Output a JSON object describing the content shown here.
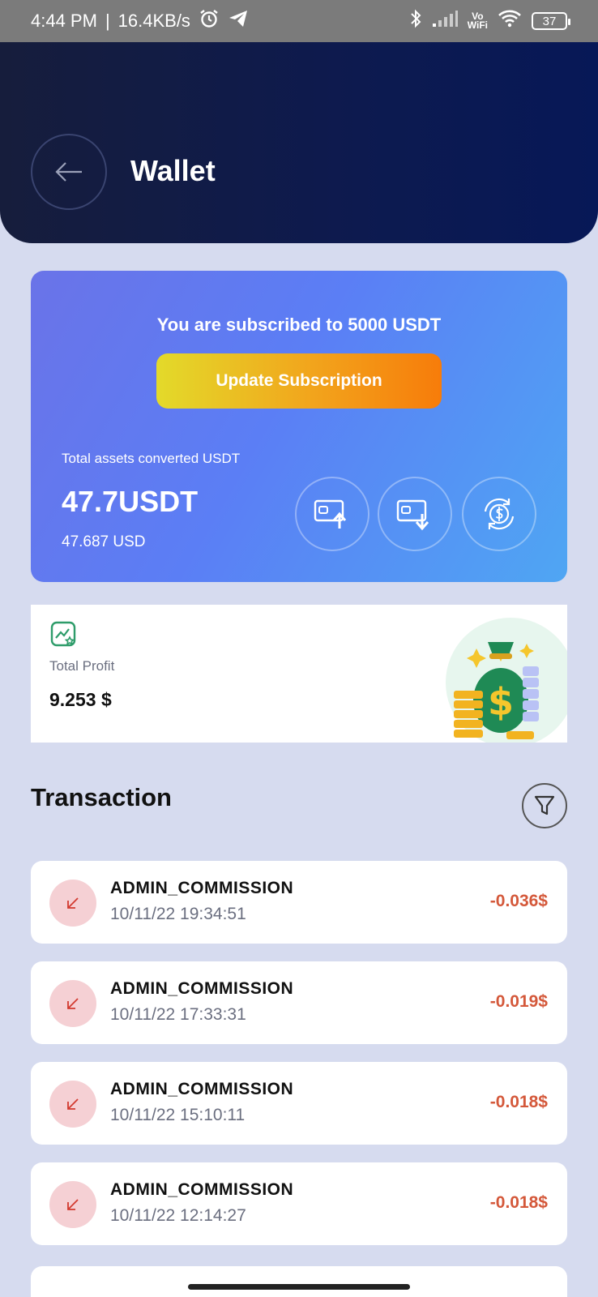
{
  "status_bar": {
    "time": "4:44 PM",
    "separator": "|",
    "speed": "16.4KB/s",
    "vowifi_top": "Vo",
    "vowifi_bottom": "WiFi",
    "battery": "37"
  },
  "header": {
    "title": "Wallet"
  },
  "balance": {
    "subscription_text": "You are subscribed to 5000 USDT",
    "update_button": "Update Subscription",
    "assets_label": "Total assets converted USDT",
    "amount": "47.7USDT",
    "usd": "47.687 USD"
  },
  "profit": {
    "label": "Total Profit",
    "value": "9.253 $"
  },
  "transactions": {
    "title": "Transaction",
    "items": [
      {
        "type": "ADMIN_COMMISSION",
        "date": "10/11/22 19:34:51",
        "amount": "-0.036$"
      },
      {
        "type": "ADMIN_COMMISSION",
        "date": "10/11/22 17:33:31",
        "amount": "-0.019$"
      },
      {
        "type": "ADMIN_COMMISSION",
        "date": "10/11/22 15:10:11",
        "amount": "-0.018$"
      },
      {
        "type": "ADMIN_COMMISSION",
        "date": "10/11/22 12:14:27",
        "amount": "-0.018$"
      }
    ]
  },
  "colors": {
    "header_bg": "#0d1a4f",
    "negative_amount": "#d4583a",
    "update_button_start": "#e3da2a",
    "update_button_end": "#f77c0a"
  },
  "icons": {
    "back": "arrow-left-icon",
    "withdraw": "wallet-upload-icon",
    "deposit": "wallet-download-icon",
    "exchange": "dollar-cycle-icon",
    "profit": "chart-star-icon",
    "filter": "filter-funnel-icon",
    "tx": "arrow-down-left-icon"
  }
}
